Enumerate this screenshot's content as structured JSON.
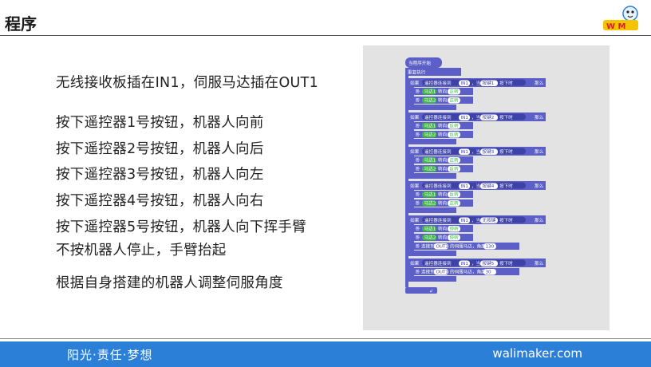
{
  "slide": {
    "title": "程序"
  },
  "content": {
    "lines": [
      "无线接收板插在IN1，伺服马达插在OUT1",
      "按下遥控器1号按钮，机器人向前",
      "按下遥控器2号按钮，机器人向后",
      "按下遥控器3号按钮，机器人向左",
      "按下遥控器4号按钮，机器人向右",
      "按下遥控器5号按钮，机器人向下挥手臂",
      "不按机器人停止，手臂抬起",
      "根据自身搭建的机器人调整伺服角度"
    ]
  },
  "code": {
    "hat": "当程序开始",
    "forever": "重复执行",
    "if_label": "如果",
    "then_label": "那么",
    "cond_prefix": "遥控器连接到",
    "cond_mid": "，当",
    "cond_suffix": "按下时",
    "port_in": "IN1",
    "port_out": "OUT1",
    "motor_prefix": "马达1",
    "motor2_prefix": "马达2",
    "turn_label": "转向",
    "forward": "正转",
    "reverse": "反转",
    "stop": "停转",
    "servo_prefix": "连接到",
    "servo_mid": "的伺服马达，角度",
    "blocks": [
      {
        "key": "按键1",
        "m1": "正转",
        "m2": "正转"
      },
      {
        "key": "按键2",
        "m1": "反转",
        "m2": "反转"
      },
      {
        "key": "按键3",
        "m1": "正转",
        "m2": "反转"
      },
      {
        "key": "按键4",
        "m1": "反转",
        "m2": "正转"
      },
      {
        "key": "无按键",
        "m1": "停转",
        "m2": "停转",
        "servo": "130"
      },
      {
        "key": "按键5",
        "servo": "30"
      }
    ]
  },
  "footer": {
    "left": "阳光·责任·梦想",
    "right": "walimaker.com"
  },
  "colors": {
    "block": "#5b5fc7",
    "block_dark": "#3e42a6",
    "reporter": "#3fb54a",
    "footer": "#2c7fd6"
  }
}
